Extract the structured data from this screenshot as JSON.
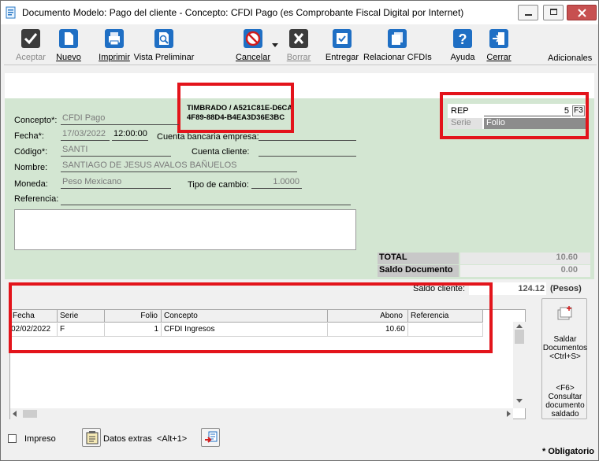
{
  "window": {
    "title": "Documento Modelo: Pago del cliente - Concepto: CFDI Pago (es Comprobante Fiscal Digital por Internet)"
  },
  "toolbar": {
    "aceptar": "Aceptar",
    "nuevo": "Nuevo",
    "imprimir": "Imprimir",
    "vista_preliminar": "Vista Preliminar",
    "cancelar": "Cancelar",
    "borrar": "Borrar",
    "entregar": "Entregar",
    "relacionar": "Relacionar CFDIs",
    "ayuda": "Ayuda",
    "cerrar": "Cerrar",
    "adicionales": "Adicionales"
  },
  "timbrado": {
    "line1": "TIMBRADO / A521C81E-D6CA",
    "line2": "4F89-88D4-B4EA3D36E3BC"
  },
  "serie_folio": {
    "serie_value": "REP",
    "folio_value": "5",
    "key_hint": "F3",
    "serie_label": "Serie",
    "folio_label": "Folio"
  },
  "form": {
    "concepto_label": "Concepto*:",
    "concepto_value": "CFDI Pago",
    "fecha_label": "Fecha*:",
    "fecha_value": "17/03/2022",
    "hora_value": "12:00:00",
    "cuenta_bancaria_label": "Cuenta bancaria empresa:",
    "codigo_label": "Código*:",
    "codigo_value": "SANTI",
    "cuenta_cliente_label": "Cuenta cliente:",
    "nombre_label": "Nombre:",
    "nombre_value": "SANTIAGO DE JESUS AVALOS BAÑUELOS",
    "moneda_label": "Moneda:",
    "moneda_value": "Peso Mexicano",
    "tipo_cambio_label": "Tipo de cambio:",
    "tipo_cambio_value": "1.0000",
    "referencia_label": "Referencia:"
  },
  "totals": {
    "total_label": "TOTAL",
    "total_value": "10.60",
    "saldo_doc_label": "Saldo Documento",
    "saldo_doc_value": "0.00",
    "saldo_cliente_label": "Saldo cliente:",
    "saldo_cliente_value": "124.12",
    "saldo_cliente_currency": "(Pesos)"
  },
  "grid": {
    "headers": [
      "Fecha",
      "Serie",
      "Folio",
      "Concepto",
      "Abono",
      "Referencia"
    ],
    "rows": [
      {
        "fecha": "02/02/2022",
        "serie": "F",
        "folio": "1",
        "concepto": "CFDI Ingresos",
        "abono": "10.60",
        "referencia": ""
      }
    ]
  },
  "side": {
    "saldar_line1": "Saldar",
    "saldar_line2": "Documentos",
    "saldar_line3": "<Ctrl+S>",
    "consultar_line1": "<F6>",
    "consultar_line2": "Consultar",
    "consultar_line3": "documento",
    "consultar_line4": "saldado"
  },
  "bottom": {
    "impreso_label": "Impreso",
    "datos_extras_label": "Datos extras",
    "datos_extras_shortcut": "<Alt+1>",
    "obligatorio": "* Obligatorio"
  }
}
